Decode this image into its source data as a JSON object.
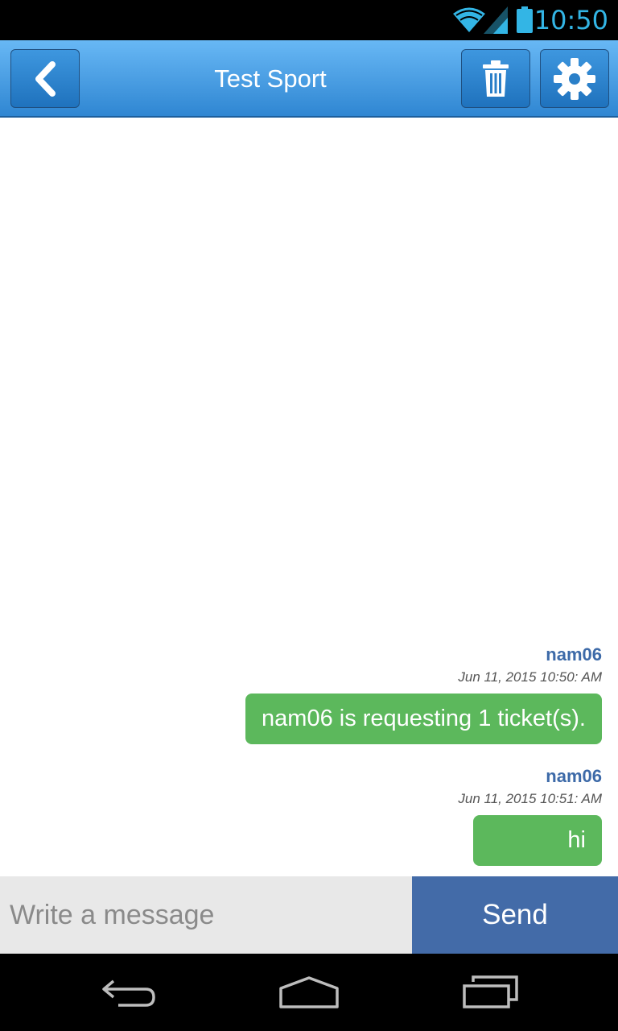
{
  "status_bar": {
    "time": "10:50",
    "icons": [
      "wifi-icon",
      "signal-icon",
      "battery-icon"
    ],
    "accent_color": "#33b5e5"
  },
  "action_bar": {
    "title": "Test Sport",
    "icons": [
      "chevron-left-icon",
      "trash-icon",
      "gear-icon"
    ],
    "color": "#3a93dc"
  },
  "messages": [
    {
      "sender": "nam06",
      "timestamp": "Jun 11, 2015 10:50: AM",
      "text": "nam06 is requesting 1 ticket(s).",
      "bubble_color": "#5cb85c"
    },
    {
      "sender": "nam06",
      "timestamp": "Jun 11, 2015 10:51: AM",
      "text": "hi",
      "bubble_color": "#5cb85c"
    }
  ],
  "composer": {
    "placeholder": "Write a message",
    "value": "",
    "send_label": "Send",
    "send_color": "#436ba8"
  },
  "nav_bar": {
    "icons": [
      "back-icon",
      "home-icon",
      "recent-apps-icon"
    ]
  }
}
